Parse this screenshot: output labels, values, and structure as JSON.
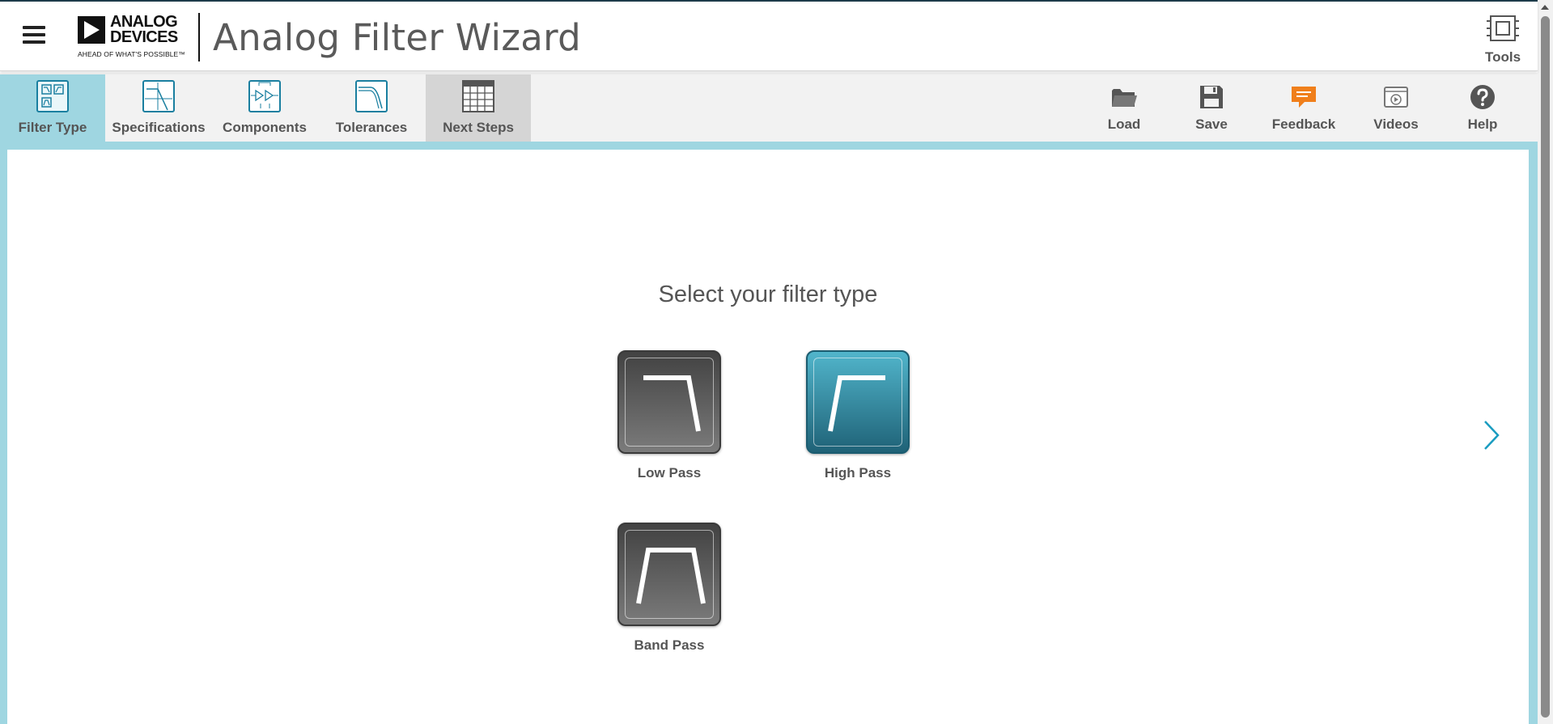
{
  "header": {
    "menu_icon": "hamburger-menu-icon",
    "logo": {
      "name_line1": "ANALOG",
      "name_line2": "DEVICES",
      "tagline": "AHEAD OF WHAT'S POSSIBLE™"
    },
    "title": "Analog Filter Wizard",
    "tools": {
      "label": "Tools",
      "icon": "chip-icon"
    }
  },
  "steps": [
    {
      "label": "Filter Type",
      "icon": "filter-type-icon",
      "state": "active"
    },
    {
      "label": "Specifications",
      "icon": "specifications-icon",
      "state": "default"
    },
    {
      "label": "Components",
      "icon": "components-icon",
      "state": "default"
    },
    {
      "label": "Tolerances",
      "icon": "tolerances-icon",
      "state": "default"
    },
    {
      "label": "Next Steps",
      "icon": "table-grid-icon",
      "state": "future"
    }
  ],
  "toolbar": [
    {
      "label": "Load",
      "icon": "folder-icon"
    },
    {
      "label": "Save",
      "icon": "floppy-disk-icon"
    },
    {
      "label": "Feedback",
      "icon": "chat-bubble-icon"
    },
    {
      "label": "Videos",
      "icon": "video-play-icon"
    },
    {
      "label": "Help",
      "icon": "question-circle-icon"
    }
  ],
  "main": {
    "prompt": "Select your filter type",
    "filters": [
      {
        "label": "Low Pass",
        "icon": "low-pass-icon",
        "selected": false
      },
      {
        "label": "High Pass",
        "icon": "high-pass-icon",
        "selected": true
      },
      {
        "label": "Band Pass",
        "icon": "band-pass-icon",
        "selected": false
      }
    ],
    "next_icon": "chevron-right-icon"
  },
  "colors": {
    "accent": "#9fd6e1",
    "active_tile": "#2a7d92",
    "inactive_tile": "#555555",
    "icon_blue": "#1a7fa0",
    "feedback_orange": "#f07f1b",
    "text": "#555555"
  }
}
